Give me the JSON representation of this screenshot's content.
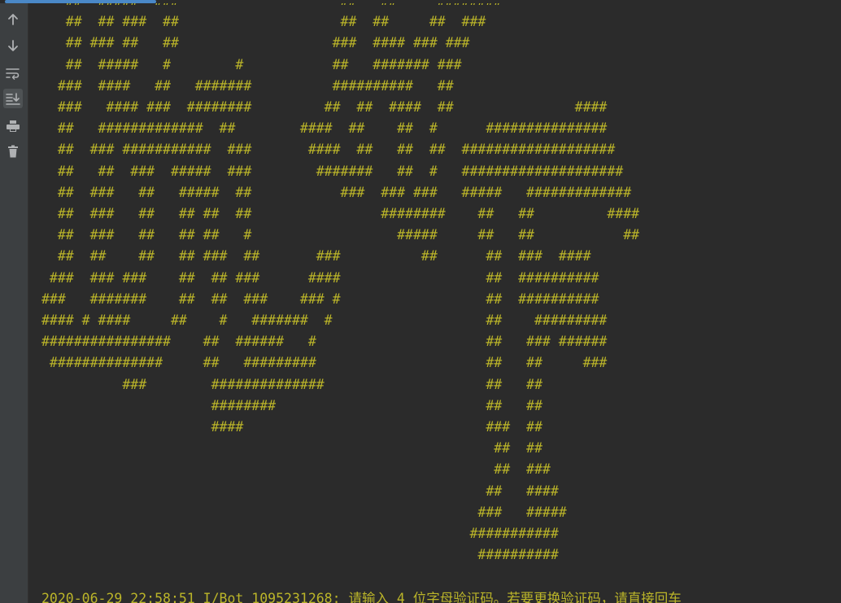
{
  "toolbar": {
    "buttons": [
      {
        "name": "up-arrow-icon",
        "label": "Up to previous occurrence"
      },
      {
        "name": "down-arrow-icon",
        "label": "Down to next occurrence"
      },
      {
        "name": "soft-wrap-icon",
        "label": "Soft-wrap"
      },
      {
        "name": "scroll-to-end-icon",
        "label": "Scroll to the end"
      },
      {
        "name": "print-icon",
        "label": "Print"
      },
      {
        "name": "trash-icon",
        "label": "Clear all"
      }
    ]
  },
  "progress": {
    "fraction": 0.18
  },
  "colors": {
    "background": "#2b2b2b",
    "toolbar": "#3c3f41",
    "output_text": "#bbb529",
    "icon": "#afb1b3",
    "progress": "#4a88c7"
  },
  "console": {
    "art_lines": [
      "   ##  #####  ###                    ##   ##     ########",
      "   ##  ## ###  ##                    ##  ##     ##  ###",
      "   ## ### ##   ##                   ###  #### ### ###",
      "   ##  #####   #        #           ##   ####### ###",
      "  ###  ####   ##   #######          ##########   ##",
      "  ###   #### ###  ########         ##  ##  ####  ##               ####",
      "  ##   #############  ##        ####  ##    ##  #      ###############",
      "  ##  ### ###########  ###       ####  ##   ##  ##  ###################",
      "  ##   ##  ###  #####  ###        #######   ##  #   ####################",
      "  ##  ###   ##   #####  ##           ###  ### ###   #####   #############",
      "  ##  ###   ##   ## ##  ##                ########    ##   ##         ####",
      "  ##  ###   ##   ## ##   #                  #####     ##   ##           ##",
      "  ##  ##    ##   ## ###  ##       ###          ##      ##  ###  ####",
      " ###  ### ###    ##  ## ###      ####                  ##  ##########",
      "###   #######    ##  ##  ###    ### #                  ##  ##########",
      "#### # ####     ##    #   #######  #                   ##    #########",
      "################    ##  ######   #                     ##   ### ######",
      " ##############     ##   #########                     ##   ##     ###",
      "          ###        ##############                    ##   ##",
      "                     ########                          ##   ##",
      "                     ####                              ###  ##",
      "                                                        ##  ##",
      "                                                        ##  ###",
      "                                                       ##   ####",
      "                                                      ###   #####",
      "                                                     ###########",
      "                                                      ##########"
    ],
    "log_line": "2020-06-29 22:58:51 I/Bot 1095231268: 请输入 4 位字母验证码。若要更换验证码，请直接回车"
  }
}
